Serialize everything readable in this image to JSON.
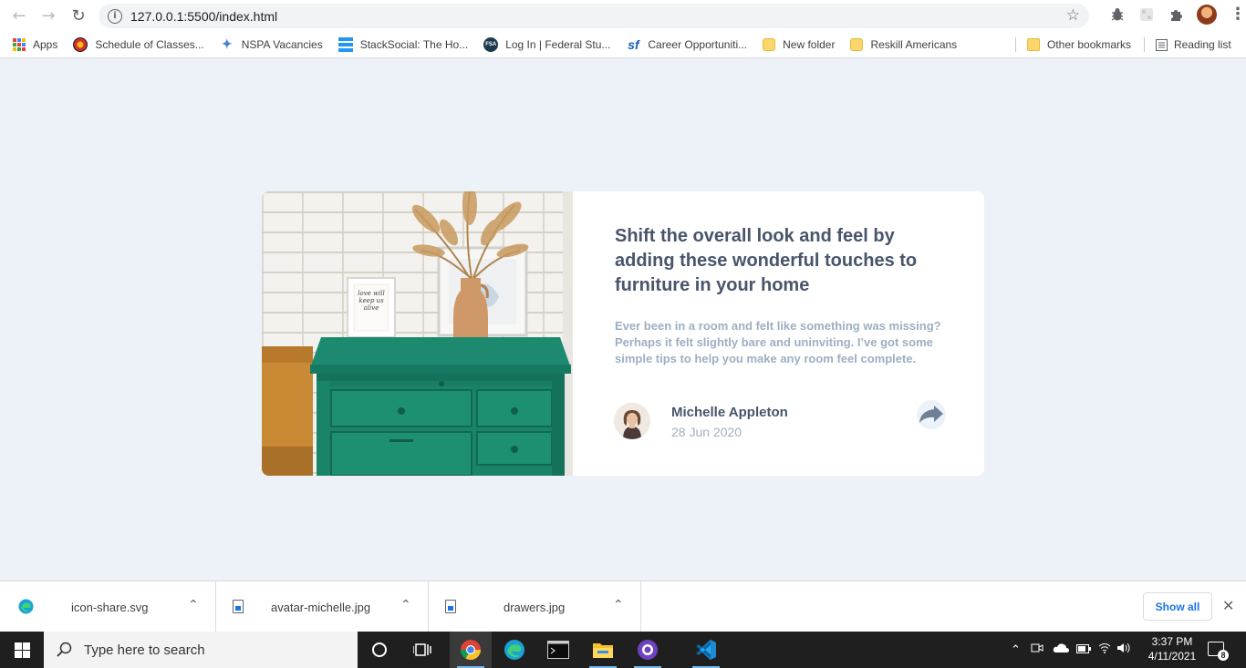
{
  "browser": {
    "url": "127.0.0.1:5500/index.html",
    "bookmarks": [
      {
        "label": "Apps",
        "icon": "apps-grid-icon"
      },
      {
        "label": "Schedule of Classes...",
        "icon": "site-favicon"
      },
      {
        "label": "NSPA Vacancies",
        "icon": "sparkle-favicon"
      },
      {
        "label": "StackSocial: The Ho...",
        "icon": "stacksocial-favicon"
      },
      {
        "label": "Log In | Federal Stu...",
        "icon": "fsa-favicon"
      },
      {
        "label": "Career Opportuniti...",
        "icon": "sf-favicon"
      },
      {
        "label": "New folder",
        "icon": "folder-icon"
      },
      {
        "label": "Reskill Americans",
        "icon": "folder-icon"
      }
    ],
    "other_bookmarks": "Other bookmarks",
    "reading_list": "Reading list"
  },
  "card": {
    "headline": "Shift the overall look and feel by adding these wonderful touches to furniture in your home",
    "excerpt": "Ever been in a room and felt like something was missing? Perhaps it felt slightly bare and uninviting. I’ve got some simple tips to help you make any room feel complete.",
    "author": "Michelle Appleton",
    "date": "28 Jun 2020",
    "frame_text": "love will keep us alive"
  },
  "downloads": {
    "items": [
      {
        "name": "icon-share.svg",
        "icon": "edge-icon"
      },
      {
        "name": "avatar-michelle.jpg",
        "icon": "file-image-icon"
      },
      {
        "name": "drawers.jpg",
        "icon": "file-image-icon"
      }
    ],
    "show_all": "Show all"
  },
  "taskbar": {
    "search_placeholder": "Type here to search",
    "time": "3:37 PM",
    "date": "4/11/2021",
    "notifications": "8"
  },
  "colors": {
    "page_bg": "#ecf2f8",
    "headline": "#48556a",
    "muted": "#9eafc2",
    "cabinet": "#1f8a70",
    "share_icon": "#6e8098"
  }
}
